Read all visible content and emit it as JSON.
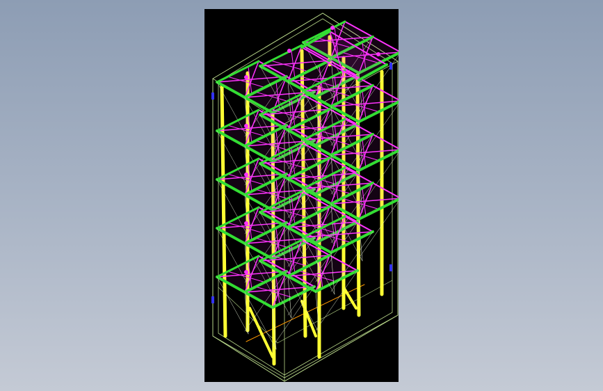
{
  "viewer": {
    "background_color": "#8d9db4",
    "viewport_color": "#000000",
    "model": "3d-wireframe-steel-rack",
    "colors": {
      "frame": "#b9d98a",
      "column": "#ffff33",
      "beam": "#33dd33",
      "brace": "#ff33ff",
      "anchor": "#3333ff",
      "base_line": "#ff9900"
    }
  }
}
